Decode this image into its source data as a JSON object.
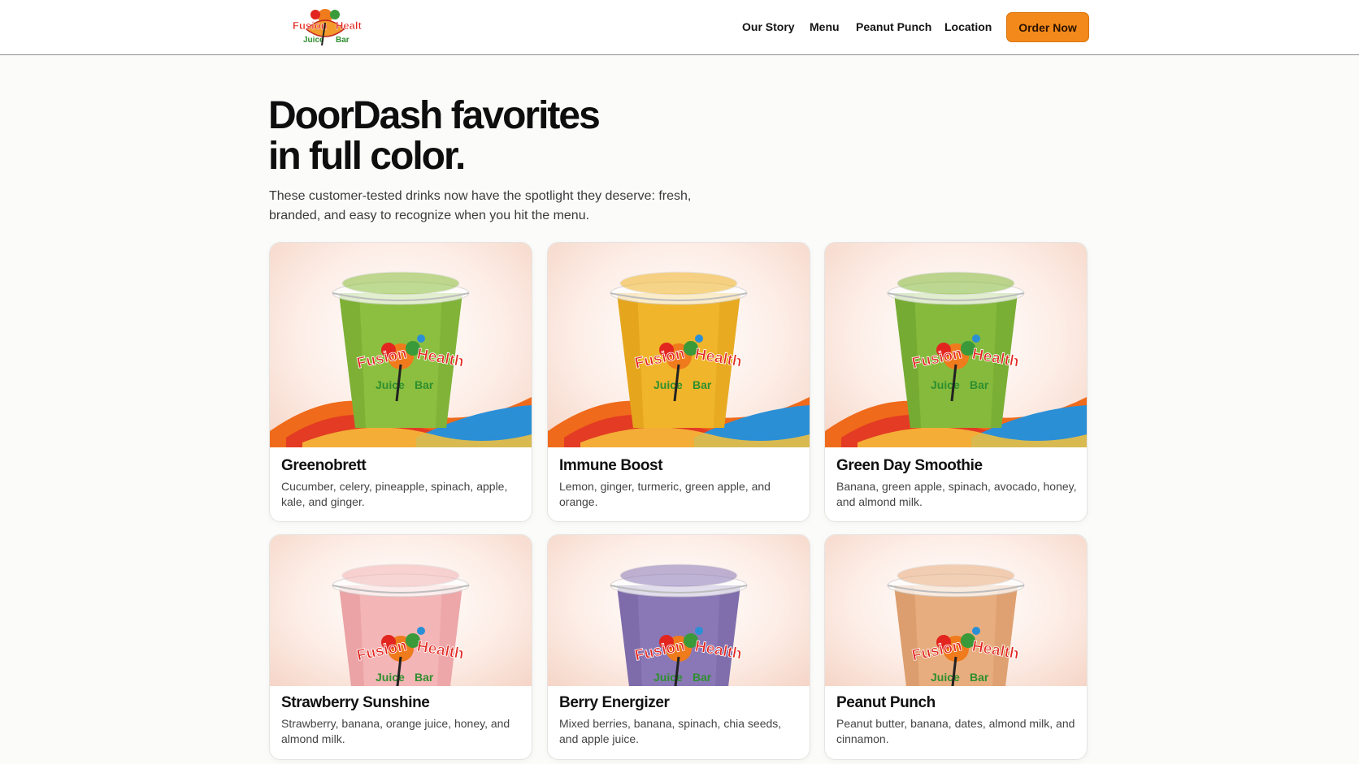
{
  "header": {
    "logo_text": "Fusion Health Juice Bar",
    "nav": [
      "Our Story",
      "Menu",
      "Peanut Punch",
      "Location"
    ],
    "cta": "Order Now"
  },
  "hero": {
    "title_line1": "DoorDash favorites",
    "title_line2": "in full color.",
    "subtitle": "These customer-tested drinks now have the spotlight they deserve: fresh, branded, and easy to recognize when you hit the menu."
  },
  "colors": {
    "accent": "#f2891a",
    "background": "#fbfbfa"
  },
  "products": [
    {
      "name": "Greenobrett",
      "desc": "Cucumber, celery, pineapple, spinach, apple, kale, and ginger.",
      "drink_color": "#8cbf3f",
      "drink_dark": "#6a9e2a"
    },
    {
      "name": "Immune Boost",
      "desc": "Lemon, ginger, turmeric, green apple, and orange.",
      "drink_color": "#f0b52a",
      "drink_dark": "#d89410"
    },
    {
      "name": "Green Day Smoothie",
      "desc": "Banana, green apple, spinach, avocado, honey, and almond milk.",
      "drink_color": "#86ba3c",
      "drink_dark": "#649a28"
    },
    {
      "name": "Strawberry Sunshine",
      "desc": "Strawberry, banana, orange juice, honey, and almond milk.",
      "drink_color": "#f3b5b5",
      "drink_dark": "#e28d92"
    },
    {
      "name": "Berry Energizer",
      "desc": "Mixed berries, banana, spinach, chia seeds, and apple juice.",
      "drink_color": "#8a78b6",
      "drink_dark": "#6c5b9c"
    },
    {
      "name": "Peanut Punch",
      "desc": "Peanut butter, banana, dates, almond milk, and cinnamon.",
      "drink_color": "#e8ad7e",
      "drink_dark": "#cf8c5c"
    }
  ]
}
